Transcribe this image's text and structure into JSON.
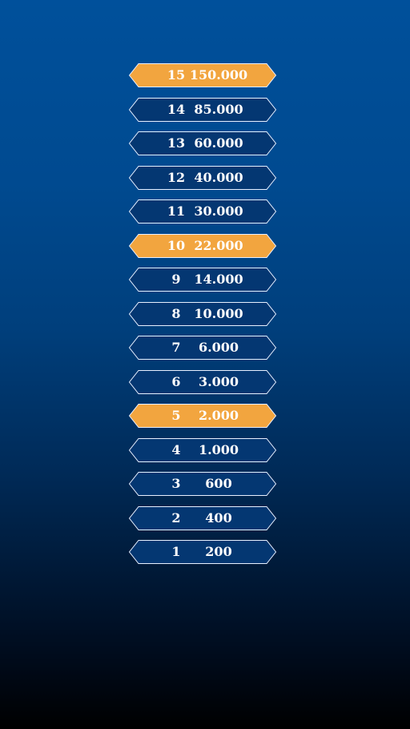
{
  "colors": {
    "normal_fill": "#043772",
    "highlight_fill": "#f2a53f",
    "border": "#e8f0ff"
  },
  "ladder": [
    {
      "level": "15",
      "amount": "150.000",
      "milestone": true
    },
    {
      "level": "14",
      "amount": "85.000",
      "milestone": false
    },
    {
      "level": "13",
      "amount": "60.000",
      "milestone": false
    },
    {
      "level": "12",
      "amount": "40.000",
      "milestone": false
    },
    {
      "level": "11",
      "amount": "30.000",
      "milestone": false
    },
    {
      "level": "10",
      "amount": "22.000",
      "milestone": true
    },
    {
      "level": "9",
      "amount": "14.000",
      "milestone": false
    },
    {
      "level": "8",
      "amount": "10.000",
      "milestone": false
    },
    {
      "level": "7",
      "amount": "6.000",
      "milestone": false
    },
    {
      "level": "6",
      "amount": "3.000",
      "milestone": false
    },
    {
      "level": "5",
      "amount": "2.000",
      "milestone": true
    },
    {
      "level": "4",
      "amount": "1.000",
      "milestone": false
    },
    {
      "level": "3",
      "amount": "600",
      "milestone": false
    },
    {
      "level": "2",
      "amount": "400",
      "milestone": false
    },
    {
      "level": "1",
      "amount": "200",
      "milestone": false
    }
  ]
}
